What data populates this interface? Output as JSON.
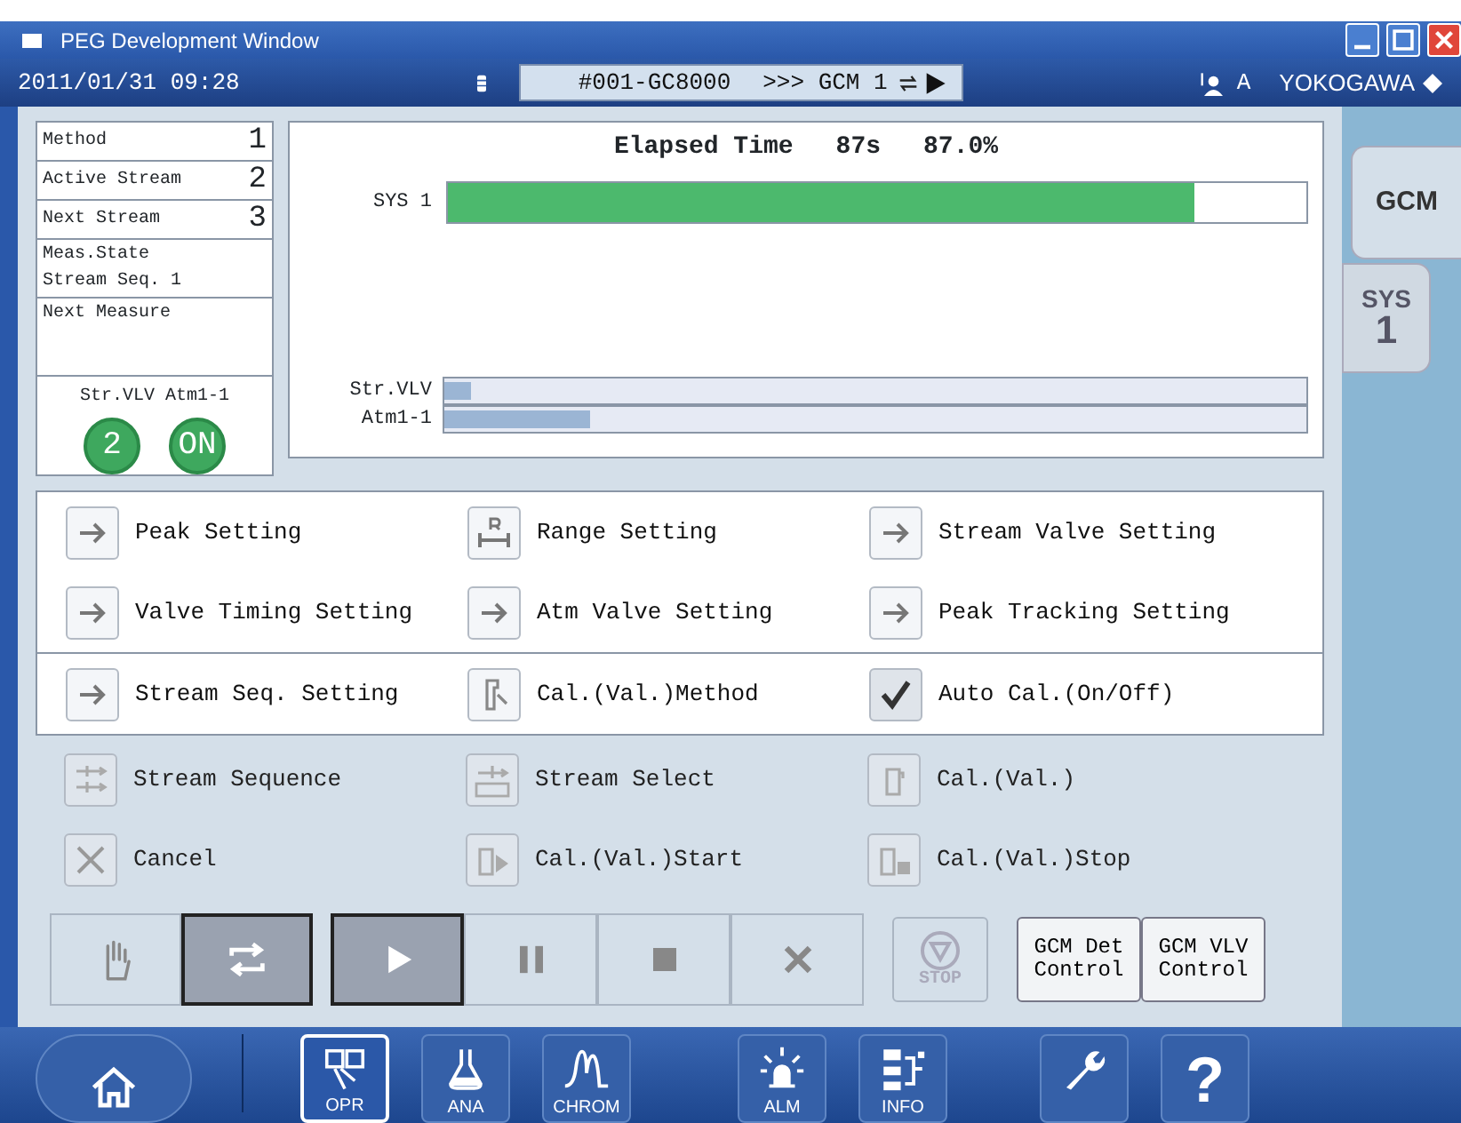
{
  "window": {
    "title": "PEG Development Window"
  },
  "header": {
    "datetime": "2011/01/31 09:28",
    "analyzer": "#001-GC8000",
    "target": ">>> GCM 1",
    "user": "A",
    "brand": "YOKOGAWA"
  },
  "status": [
    {
      "label": "Method",
      "value": "1"
    },
    {
      "label": "Active Stream",
      "value": "2"
    },
    {
      "label": "Next Stream",
      "value": "3"
    },
    {
      "label": "Meas.State",
      "value": "Stream Seq. 1"
    },
    {
      "label": "Next Measure"
    }
  ],
  "indicators": {
    "title": "Str.VLV Atm1-1",
    "lamps": [
      {
        "text": "2",
        "on": true
      },
      {
        "text": "ON",
        "on": true
      }
    ]
  },
  "progress": {
    "label": "Elapsed Time",
    "seconds": "87s",
    "percent": "87.0%",
    "system": {
      "name": "SYS 1",
      "level": 0.87
    },
    "valves": [
      {
        "name": "Str.VLV",
        "level": 0.03
      },
      {
        "name": "Atm1-1",
        "level": 0.17
      }
    ]
  },
  "menu": [
    {
      "label": "Peak Setting",
      "kind": "arrow",
      "disabled": false
    },
    {
      "label": "Range Setting",
      "kind": "range",
      "disabled": false
    },
    {
      "label": "Stream Valve Setting",
      "kind": "arrow",
      "disabled": false
    },
    {
      "label": "Valve Timing Setting",
      "kind": "arrow",
      "disabled": false
    },
    {
      "label": "Atm Valve Setting",
      "kind": "arrow",
      "disabled": false
    },
    {
      "label": "Peak Tracking Setting",
      "kind": "arrow",
      "disabled": false
    },
    {
      "label": "Stream Seq. Setting",
      "kind": "arrow",
      "disabled": false
    },
    {
      "label": "Cal.(Val.)Method",
      "kind": "tool",
      "disabled": false
    },
    {
      "label": "Auto Cal.(On/Off)",
      "kind": "check",
      "disabled": false,
      "checked": true
    },
    {
      "label": "Stream Sequence",
      "kind": "sequence",
      "disabled": true
    },
    {
      "label": "Stream Select",
      "kind": "select",
      "disabled": true
    },
    {
      "label": "Cal.(Val.)",
      "kind": "cal",
      "disabled": true
    },
    {
      "label": "Cancel",
      "kind": "cancel",
      "disabled": true
    },
    {
      "label": "Cal.(Val.)Start",
      "kind": "calstart",
      "disabled": true
    },
    {
      "label": "Cal.(Val.)Stop",
      "kind": "calstop",
      "disabled": true
    }
  ],
  "modes": [
    {
      "kind": "hand",
      "selected": false
    },
    {
      "kind": "cycle",
      "selected": true
    }
  ],
  "run": [
    {
      "kind": "play",
      "selected": true
    },
    {
      "kind": "pause",
      "selected": false
    },
    {
      "kind": "stop",
      "selected": false
    },
    {
      "kind": "abort",
      "selected": false
    }
  ],
  "emergency": {
    "label": "STOP"
  },
  "controls": [
    "GCM Det Control",
    "GCM VLV Control"
  ],
  "tabs": [
    {
      "label": "GCM",
      "selected": true
    },
    {
      "label": "SYS",
      "sub": "1",
      "selected": false
    }
  ],
  "nav": [
    {
      "kind": "home",
      "selected": false
    },
    {
      "kind": "opr",
      "label": "OPR",
      "selected": true
    },
    {
      "kind": "ana",
      "label": "ANA",
      "selected": false
    },
    {
      "kind": "chrom",
      "label": "CHROM",
      "selected": false
    },
    {
      "kind": "alm",
      "label": "ALM",
      "selected": false
    },
    {
      "kind": "info",
      "label": "INFO",
      "selected": false
    },
    {
      "kind": "tool",
      "selected": false
    },
    {
      "kind": "help",
      "label": "?",
      "selected": false
    }
  ]
}
